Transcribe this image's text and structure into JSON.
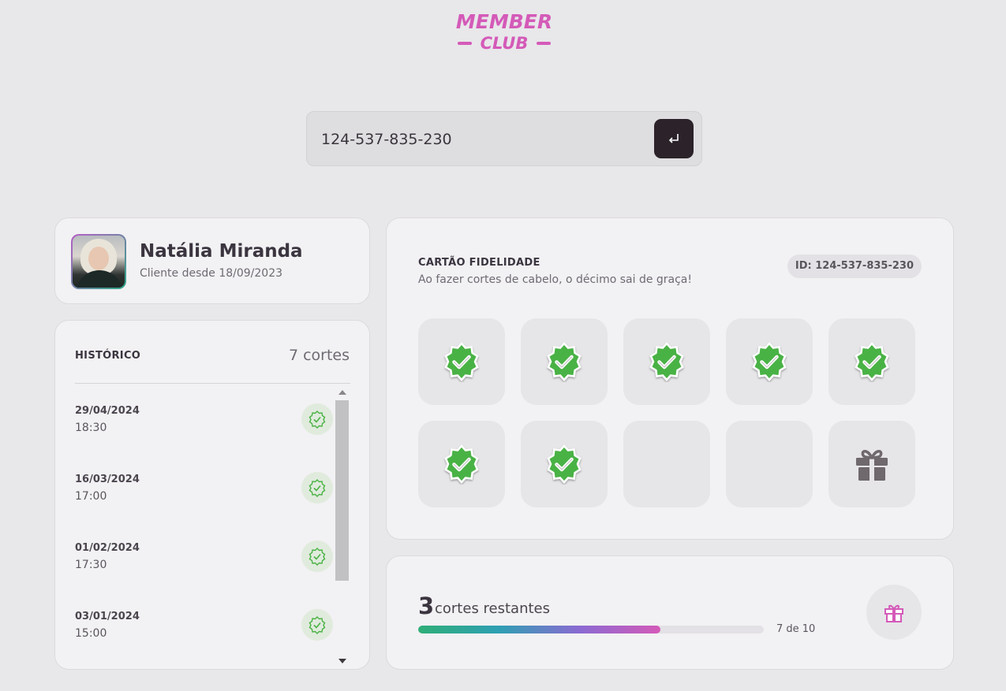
{
  "logo": {
    "line1": "MEMBER",
    "line2": "CLUB",
    "color": "#d45ab8"
  },
  "search": {
    "value": "124-537-835-230",
    "submit_icon": "enter-icon"
  },
  "profile": {
    "name": "Natália Miranda",
    "since": "Cliente desde 18/09/2023"
  },
  "history": {
    "title": "HISTÓRICO",
    "count": "7 cortes",
    "items": [
      {
        "date": "29/04/2024",
        "time": "18:30",
        "icon": "check-badge-icon"
      },
      {
        "date": "16/03/2024",
        "time": "17:00",
        "icon": "check-badge-icon"
      },
      {
        "date": "01/02/2024",
        "time": "17:30",
        "icon": "check-badge-icon"
      },
      {
        "date": "03/01/2024",
        "time": "15:00",
        "icon": "check-badge-icon"
      }
    ]
  },
  "loyalty": {
    "title": "CARTÃO FIDELIDADE",
    "subtitle": "Ao fazer cortes de cabelo, o décimo sai de graça!",
    "id_label": "ID: 124-537-835-230",
    "slots": [
      "check",
      "check",
      "check",
      "check",
      "check",
      "check",
      "check",
      "empty",
      "empty",
      "gift"
    ],
    "check_color": "#4ab244"
  },
  "progress": {
    "remaining": "3",
    "remaining_label": "cortes restantes",
    "of_label": "7 de 10",
    "fraction": 0.7,
    "button_icon": "gift-icon"
  }
}
